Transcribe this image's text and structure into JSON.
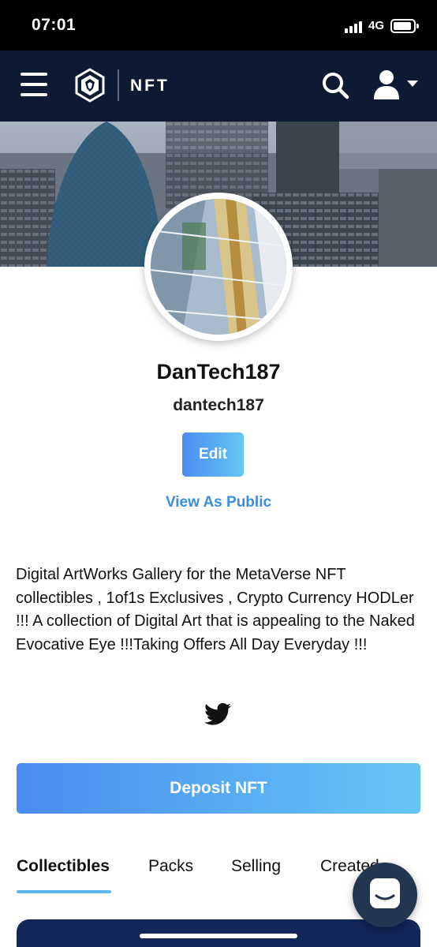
{
  "status_bar": {
    "time": "07:01",
    "network": "4G"
  },
  "nav": {
    "section_label": "NFT",
    "icons": {
      "menu": "hamburger-menu-icon",
      "logo": "crypto-com-lion-logo",
      "search": "search-icon",
      "user": "user-icon",
      "dropdown": "caret-down-icon"
    }
  },
  "profile": {
    "display_name": "DanTech187",
    "username": "dantech187",
    "edit_label": "Edit",
    "view_public_label": "View As Public",
    "bio": "Digital ArtWorks Gallery for the MetaVerse NFT collectibles , 1of1s Exclusives , Crypto Currency HODLer !!! A collection of Digital Art that is appealing to the Naked Evocative Eye !!!Taking Offers All Day Everyday !!!",
    "social_icon": "twitter-icon"
  },
  "actions": {
    "deposit_label": "Deposit NFT"
  },
  "tabs": [
    {
      "label": "Collectibles",
      "active": true
    },
    {
      "label": "Packs",
      "active": false
    },
    {
      "label": "Selling",
      "active": false
    },
    {
      "label": "Created",
      "active": false
    }
  ],
  "chat": {
    "icon": "chat-support-icon"
  },
  "colors": {
    "nav_bg": "#0c1a33",
    "accent_start": "#4a8cf0",
    "accent_end": "#66c6f5",
    "link": "#3b8de0",
    "tab_underline": "#5cb7ee",
    "card_bg": "#12265a",
    "chat_bg": "#22374f"
  }
}
